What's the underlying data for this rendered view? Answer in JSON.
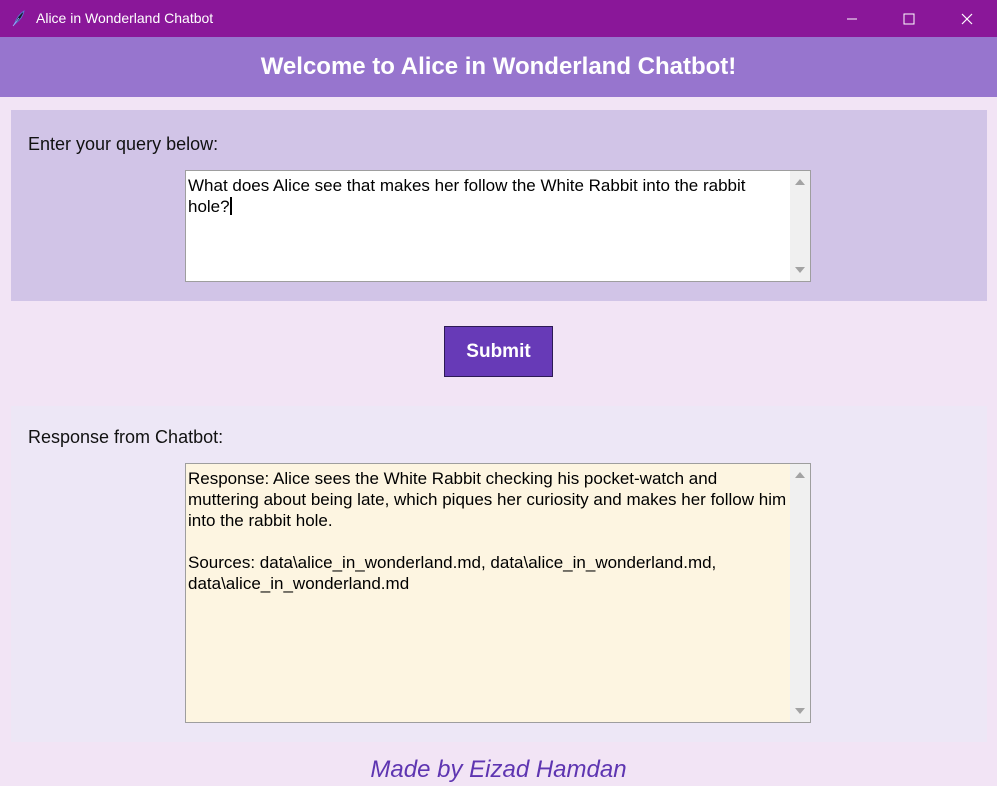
{
  "window": {
    "title": "Alice in Wonderland Chatbot",
    "icon": "feather-icon",
    "controls": [
      "minimize-icon",
      "maximize-icon",
      "close-icon"
    ]
  },
  "header": {
    "title": "Welcome to Alice in Wonderland Chatbot!"
  },
  "query": {
    "label": "Enter your query below:",
    "value": "What does Alice see that makes her follow the White Rabbit into the rabbit hole?"
  },
  "submit": {
    "label": "Submit"
  },
  "response": {
    "label": "Response from Chatbot:",
    "text": "Response: Alice sees the White Rabbit checking his pocket-watch and muttering about being late, which piques her curiosity and makes her follow him into the rabbit hole.\n\nSources: data\\alice_in_wonderland.md, data\\alice_in_wonderland.md, data\\alice_in_wonderland.md"
  },
  "footer": {
    "text": "Made by Eizad Hamdan"
  },
  "colors": {
    "titlebar": "#8a1799",
    "banner": "#9775ce",
    "query_panel": "#d1c4e7",
    "response_panel": "#ede7f6",
    "response_box": "#fdf5e1",
    "button": "#673ab7",
    "footer_text": "#5e35b1"
  }
}
